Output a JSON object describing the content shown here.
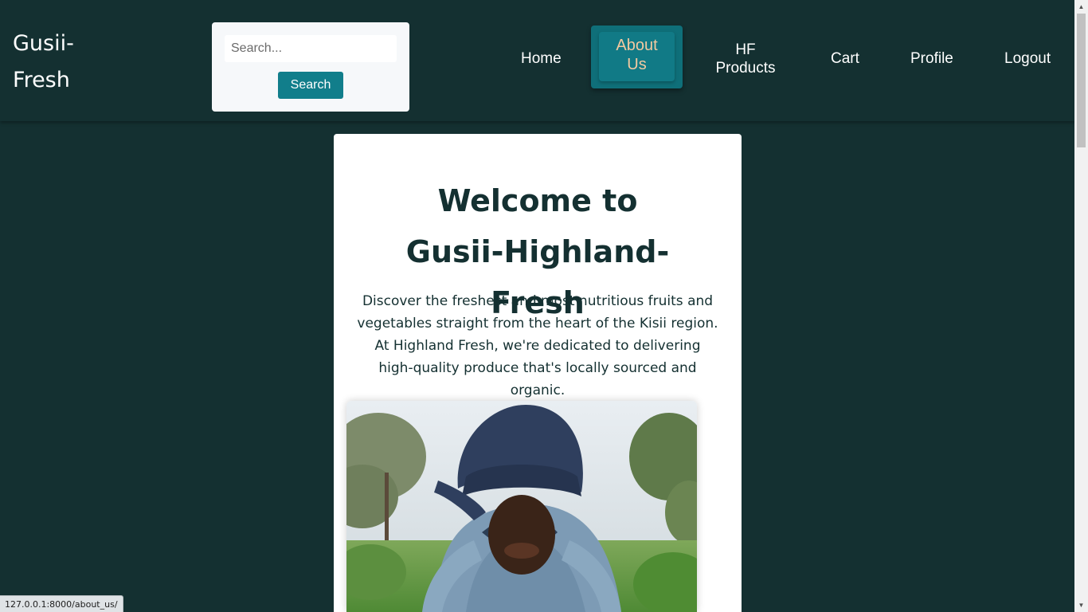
{
  "brand": {
    "name": "Gusii-\nFresh"
  },
  "search": {
    "placeholder": "Search...",
    "button_label": "Search"
  },
  "nav": {
    "home": "Home",
    "about": "About\nUs",
    "products": "HF\nProducts",
    "cart": "Cart",
    "profile": "Profile",
    "logout": "Logout"
  },
  "hero": {
    "title": "Welcome to Gusii-Highland-Fresh",
    "text": "Discover the freshest and most nutritious fruits and vegetables straight from the heart of the Kisii region. At Highland Fresh, we're dedicated to delivering high-quality produce that's locally sourced and organic."
  },
  "status": {
    "url": "127.0.0.1:8000/about_us/"
  },
  "colors": {
    "background": "#143031",
    "accent": "#117e8b",
    "active_nav_text": "#f3c9a0",
    "card": "#ffffff"
  },
  "icons": {
    "scroll_up": "triangle-up",
    "scroll_down": "triangle-down"
  }
}
